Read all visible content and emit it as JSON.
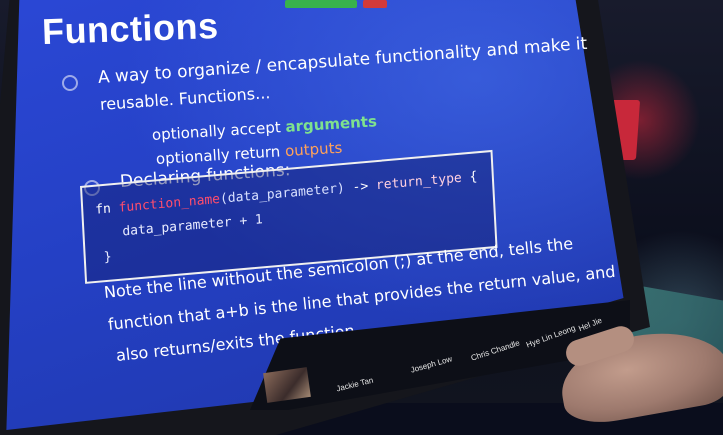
{
  "slide": {
    "title": "Functions",
    "bullet1_line1": "A way to organize / encapsulate functionality and make it",
    "bullet1_line2": "reusable. Functions...",
    "sub1_prefix": "optionally accept ",
    "sub1_highlight": "arguments",
    "sub2_prefix": "optionally return ",
    "sub2_highlight": "outputs",
    "bullet2": "Declaring functions:",
    "code": {
      "fn_kw": "fn ",
      "fn_name": "function_name",
      "params": "(data_parameter)",
      "arrow": " -> ",
      "return_type": "return_type",
      "open_brace": " {",
      "body": "data_parameter + 1",
      "close_brace": "}"
    },
    "note_line1": "Note the line without the semicolon (;) at the end, tells the",
    "note_line2": "function that a+b is the line that provides the return value, and",
    "note_line3": "also returns/exits the function"
  },
  "participants": [
    "Jackie Tan",
    "Joseph Low",
    "Chris Chandle",
    "Hye Lin Leong",
    "Hel Jie"
  ],
  "colors": {
    "slide_bg": "#2440c4",
    "argument_highlight": "#7fe28e",
    "output_highlight": "#ffa25a",
    "function_name": "#ff4d6d"
  }
}
